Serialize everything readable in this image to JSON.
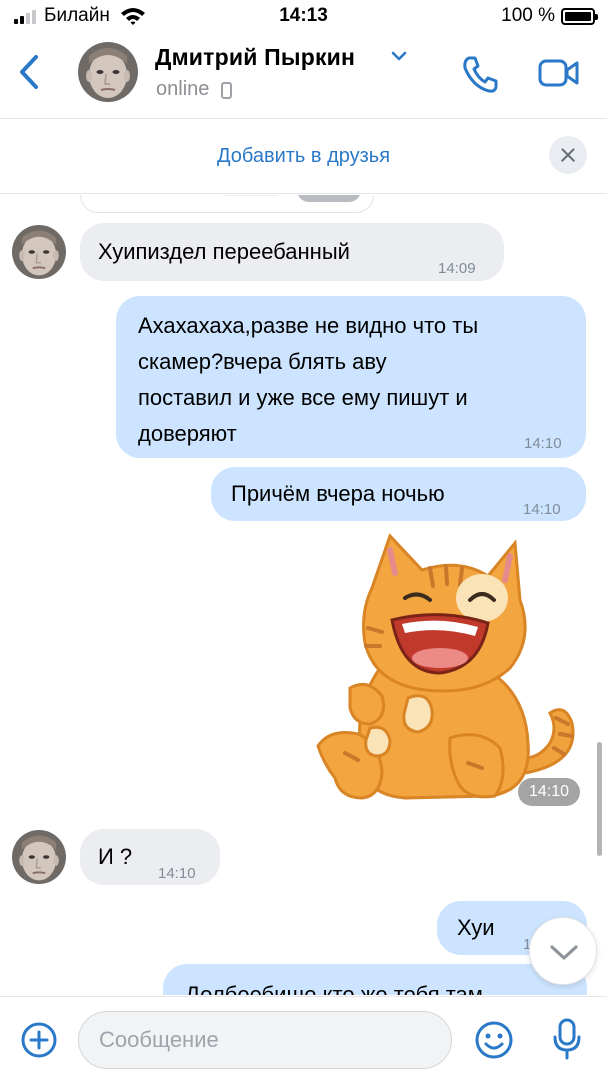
{
  "status_bar": {
    "carrier": "Билайн",
    "time": "14:13",
    "battery": "100 %"
  },
  "header": {
    "name": "Дмитрий Пыркин",
    "status": "online"
  },
  "friend_bar": {
    "label": "Добавить в друзья"
  },
  "messages": [
    {
      "direction": "in",
      "text": "Хуипиздел переебанный",
      "time": "14:09"
    },
    {
      "direction": "out",
      "lines": [
        "Ахахахаха,разве не видно что ты",
        "скамер?вчера блять аву",
        "поставил и уже все ему пишут и",
        "доверяют"
      ],
      "time": "14:10"
    },
    {
      "direction": "out",
      "text": "Причём вчера ночью",
      "time": "14:10"
    },
    {
      "direction": "out",
      "type": "sticker",
      "sticker": "laughing-orange-cat",
      "time": "14:10"
    },
    {
      "direction": "in",
      "text": "И ?",
      "time": "14:10"
    },
    {
      "direction": "out",
      "text": "Хуи",
      "time": "1"
    },
    {
      "direction": "out",
      "text": "Долбоебище кто же тебя там"
    }
  ],
  "input": {
    "placeholder": "Сообщение"
  },
  "icons": {
    "back": "chevron-left-icon",
    "call": "phone-icon",
    "video": "video-camera-icon",
    "close": "close-icon",
    "add": "plus-circle-icon",
    "emoji": "smiley-icon",
    "mic": "microphone-icon",
    "scroll_down": "chevron-down-icon"
  },
  "colors": {
    "accent": "#2a78c8",
    "incoming_bubble": "#ebedf0",
    "outgoing_bubble": "#cce4ff"
  }
}
